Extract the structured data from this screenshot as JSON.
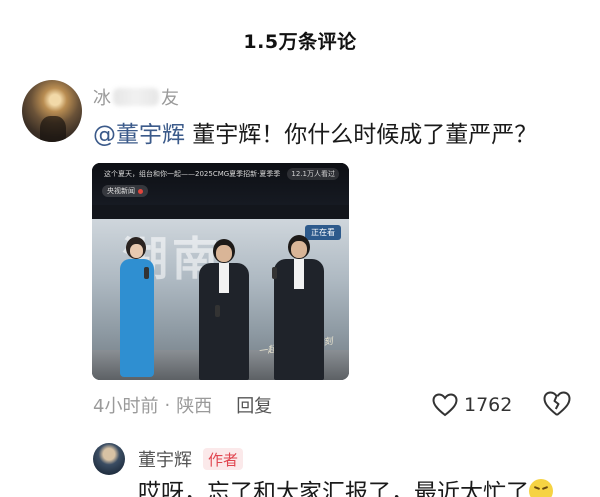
{
  "header": {
    "title": "1.5万条评论"
  },
  "comment1": {
    "username_prefix": "冰",
    "username_suffix": "友",
    "mention": "@董宇辉",
    "text": " 董宇辉！你什么时候成了董严严？",
    "time": "4小时前",
    "separator": "·",
    "location": "陕西",
    "reply_label": "回复",
    "likes": "1762",
    "icons": {
      "like": "heart-outline-icon",
      "dislike": "broken-heart-icon"
    },
    "video": {
      "banner_text": "这个夏天，组台和你一起——2025CMG夏季招新·夏季季",
      "viewers": "12.1万人看过",
      "channel": "央视新闻",
      "tag": "正在看",
      "stage_text": "湖南",
      "signature": "一起迎夏 高光时刻"
    }
  },
  "comment2": {
    "username": "董宇辉",
    "badge": "作者",
    "text_partial": "哎呀，忘了和大家汇报了，最近太忙了",
    "emoji": "grimace-emoji-icon"
  }
}
